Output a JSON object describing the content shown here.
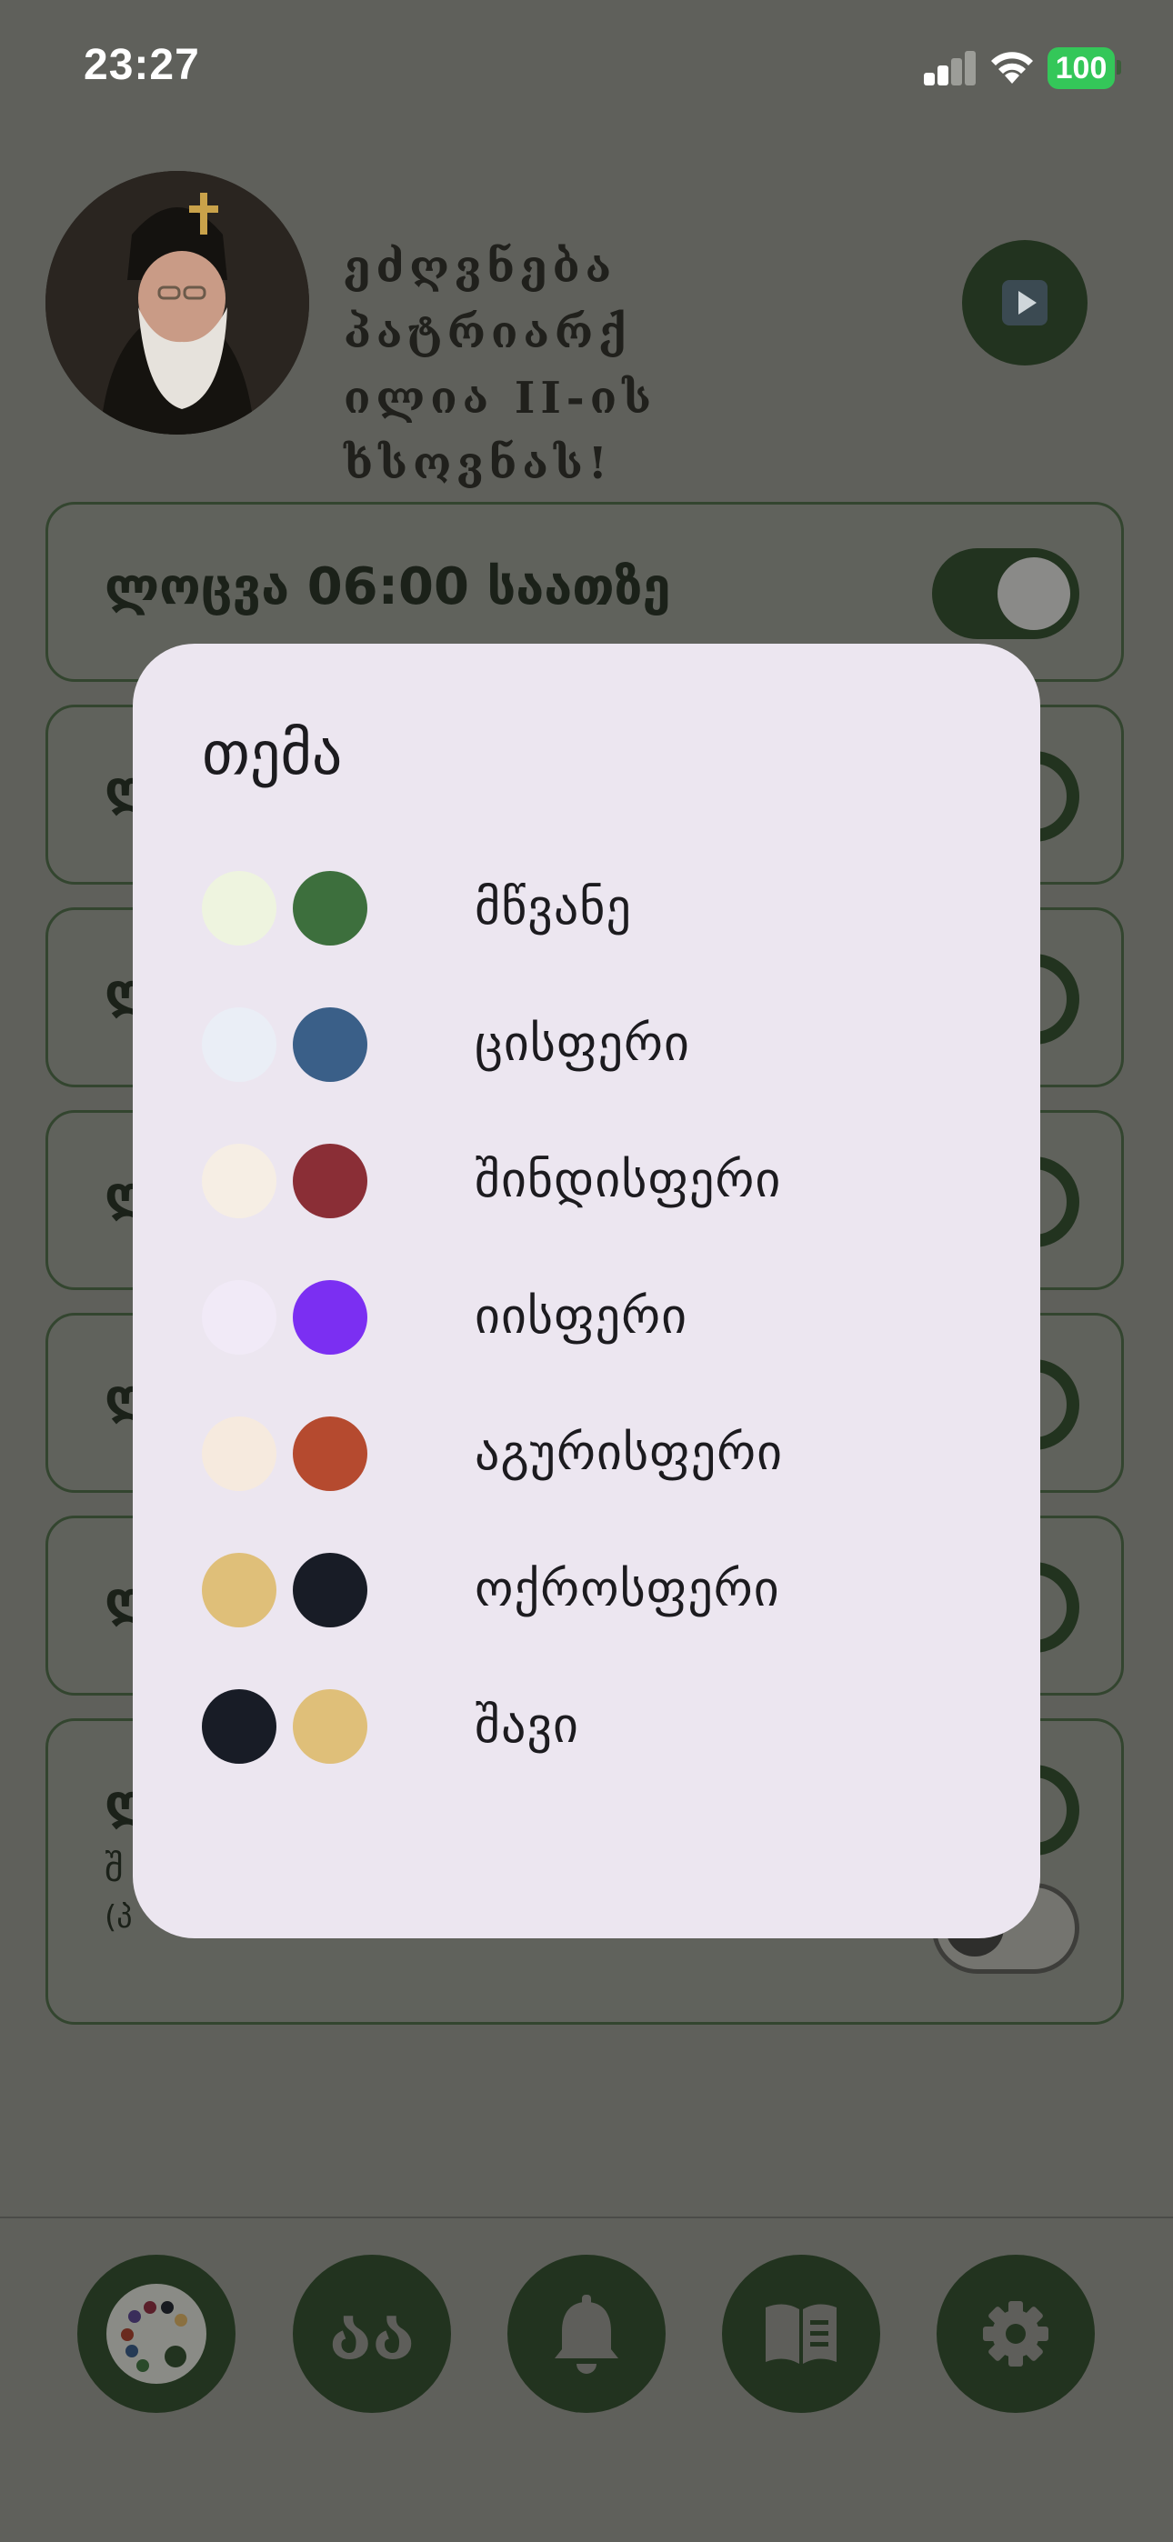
{
  "status_bar": {
    "time": "23:27",
    "battery": "100"
  },
  "header": {
    "title_line1": "ეძღვნება პატრიარქ",
    "title_line2": "ილია II-ის ხსოვნას!"
  },
  "alarms": [
    {
      "label": "ლოცვა 06:00 საათზე"
    },
    {
      "label": "ლ"
    },
    {
      "label": "ლ"
    },
    {
      "label": "ლ"
    },
    {
      "label": "ლ"
    },
    {
      "label": "ლ"
    },
    {
      "label": "ლ",
      "sub_label": "შ",
      "sub_label_2": "(პ"
    }
  ],
  "nav": {
    "letters_label": " აა"
  },
  "theme_dialog": {
    "title": "თემა",
    "options": [
      {
        "label": "მწვანე",
        "light": "#eef4df",
        "dark": "#3d6f3d"
      },
      {
        "label": "ცისფერი",
        "light": "#eaeef6",
        "dark": "#3a5f88"
      },
      {
        "label": "შინდისფერი",
        "light": "#f6eee4",
        "dark": "#8a2e36"
      },
      {
        "label": "იისფერი",
        "light": "#f1eaf7",
        "dark": "#7b2ff2"
      },
      {
        "label": "აგურისფერი",
        "light": "#f6eade",
        "dark": "#b54a2f"
      },
      {
        "label": "ოქროსფერი",
        "light": "#dfbf79",
        "dark": "#181c26"
      },
      {
        "label": "შავი",
        "light": "#181c26",
        "dark": "#dfbf79"
      }
    ]
  },
  "colors": {
    "scrim": "#5f605b",
    "primary_dark": "#22331f",
    "dialog_bg": "#ece6f0"
  }
}
